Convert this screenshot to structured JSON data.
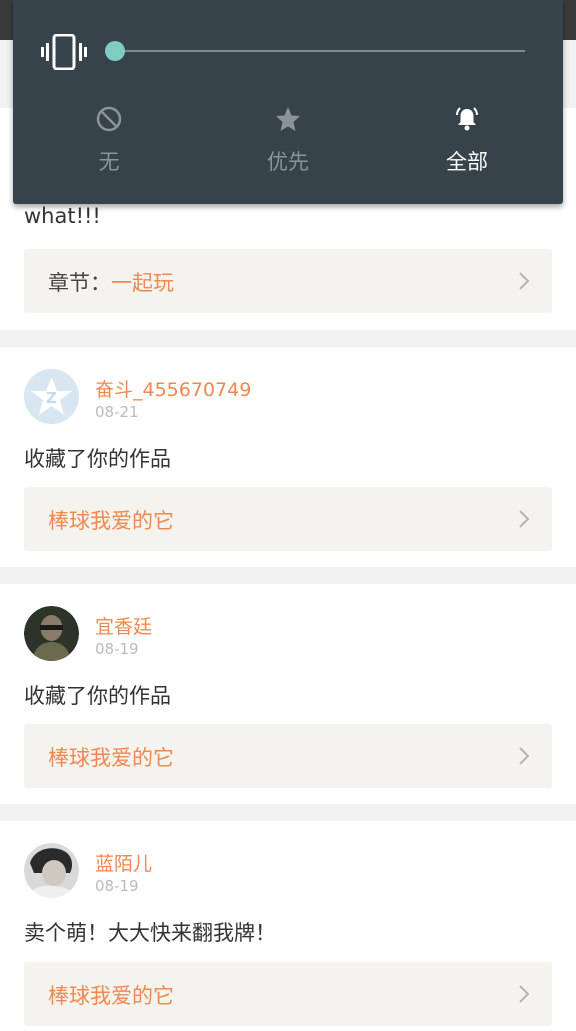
{
  "sound_panel": {
    "vibrate_level": 0,
    "modes": [
      {
        "label": "无",
        "icon": "do-not-disturb-icon",
        "active": false
      },
      {
        "label": "优先",
        "icon": "star-icon",
        "active": false
      },
      {
        "label": "全部",
        "icon": "bell-icon",
        "active": true
      }
    ]
  },
  "feed": {
    "cards": [
      {
        "message": "what!!!",
        "link_prefix": "章节：",
        "link_text": "一起玩"
      },
      {
        "user": "奋斗_455670749",
        "date": "08-21",
        "message": "收藏了你的作品",
        "link_text": "棒球我爱的它"
      },
      {
        "user": "宜香廷",
        "date": "08-19",
        "message": "收藏了你的作品",
        "link_text": "棒球我爱的它"
      },
      {
        "user": "蓝陌儿",
        "date": "08-19",
        "message": "卖个萌！大大快来翻我牌！",
        "link_text": "棒球我爱的它"
      }
    ]
  },
  "colors": {
    "accent": "#f0884f",
    "panel": "#37434a",
    "slider": "#80cbc4"
  }
}
